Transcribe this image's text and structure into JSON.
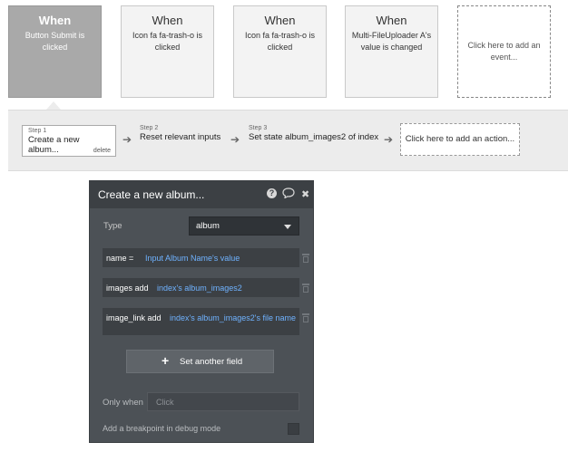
{
  "events": [
    {
      "when": "When",
      "desc": "Button Submit is clicked",
      "active": true
    },
    {
      "when": "When",
      "desc": "Icon fa fa-trash-o is clicked",
      "active": false
    },
    {
      "when": "When",
      "desc": "Icon fa fa-trash-o is clicked",
      "active": false
    },
    {
      "when": "When",
      "desc": "Multi-FileUploader A's value is changed",
      "active": false
    }
  ],
  "add_event": "Click here to add an event...",
  "steps": [
    {
      "num": "Step 1",
      "label": "Create a new album...",
      "delete": "delete"
    },
    {
      "num": "Step 2",
      "label": "Reset relevant inputs"
    },
    {
      "num": "Step 3",
      "label": "Set state album_images2 of index"
    }
  ],
  "add_action": "Click here to add an action...",
  "panel": {
    "title": "Create a new album...",
    "type_label": "Type",
    "type_value": "album",
    "fields": [
      {
        "name": "name =",
        "value": "Input Album Name's value"
      },
      {
        "name": "images add",
        "value": "index's album_images2"
      },
      {
        "name": "image_link add",
        "value": "index's album_images2's file name"
      }
    ],
    "set_field": "Set another field",
    "only_when_label": "Only when",
    "only_when_placeholder": "Click",
    "breakpoint_label": "Add a breakpoint in debug mode"
  },
  "colors": {
    "accent_link": "#6fb2ff",
    "panel_bg": "#4c5156",
    "panel_header": "#3c4044",
    "active_event": "#a9a9a9"
  },
  "icons": [
    "help-icon",
    "comment-icon",
    "close-icon",
    "trash-icon",
    "plus-icon",
    "chevron-down-icon",
    "arrow-right-icon"
  ]
}
